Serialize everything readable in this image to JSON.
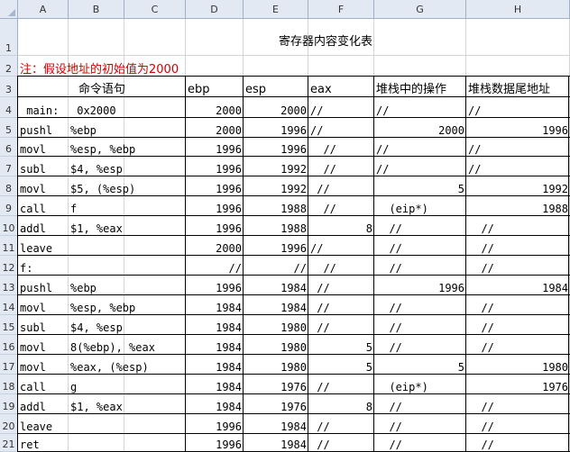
{
  "columns": [
    "A",
    "B",
    "C",
    "D",
    "E",
    "F",
    "G",
    "H"
  ],
  "rows": [
    "1",
    "2",
    "3",
    "4",
    "5",
    "6",
    "7",
    "8",
    "9",
    "10",
    "11",
    "12",
    "13",
    "14",
    "15",
    "16",
    "17",
    "18",
    "19",
    "20",
    "21"
  ],
  "title": "寄存器内容变化表",
  "note": "注：假设地址的初始值为2000",
  "headers": {
    "cmd": "命令语句",
    "ebp": "ebp",
    "esp": "esp",
    "eax": "eax",
    "op": "堆栈中的操作",
    "addr": "堆栈数据尾地址"
  },
  "table": [
    {
      "a": " main:",
      "b": " 0x2000",
      "d": "2000",
      "e": "2000",
      "f": "//",
      "g": "//",
      "h": "//"
    },
    {
      "a": "pushl",
      "b": "%ebp",
      "d": "2000",
      "e": "1996",
      "f": "//",
      "g": "2000",
      "h": "1996"
    },
    {
      "a": "movl",
      "b": "%esp, %ebp",
      "d": "1996",
      "e": "1996",
      "f": "  //",
      "g": "//",
      "h": "//"
    },
    {
      "a": "subl",
      "b": "$4, %esp",
      "d": "1996",
      "e": "1992",
      "f": "  //",
      "g": "//",
      "h": "//"
    },
    {
      "a": "movl",
      "b": "$5, (%esp)",
      "d": "1996",
      "e": "1992",
      "f": " //",
      "g": "5",
      "h": "1992"
    },
    {
      "a": "call",
      "b": "f",
      "d": "1996",
      "e": "1988",
      "f": "  //",
      "g": "  (eip*)",
      "h": "1988"
    },
    {
      "a": "addl",
      "b": "$1, %eax",
      "d": "1996",
      "e": "1988",
      "f": "8",
      "g": "  //",
      "h": "  //"
    },
    {
      "a": "leave",
      "b": "",
      "d": "2000",
      "e": "1996",
      "f": "//",
      "g": "  //",
      "h": "  //"
    },
    {
      "a": "f:",
      "b": "",
      "d": "//",
      "e": "//",
      "f": "  //",
      "g": "  //",
      "h": "  //"
    },
    {
      "a": "pushl",
      "b": "%ebp",
      "d": "1996",
      "e": "1984",
      "f": " //",
      "g": "1996",
      "h": "1984"
    },
    {
      "a": "movl",
      "b": "%esp, %ebp",
      "d": "1984",
      "e": "1984",
      "f": " //",
      "g": "  //",
      "h": "  //"
    },
    {
      "a": "subl",
      "b": "$4, %esp",
      "d": "1984",
      "e": "1980",
      "f": " //",
      "g": "  //",
      "h": "  //"
    },
    {
      "a": "movl",
      "b": "8(%ebp), %eax",
      "d": "1984",
      "e": "1980",
      "f": "5",
      "g": "  //",
      "h": "  //"
    },
    {
      "a": "movl",
      "b": "%eax, (%esp)",
      "d": "1984",
      "e": "1980",
      "f": "5",
      "g": "5",
      "h": "1980"
    },
    {
      "a": "call",
      "b": "g",
      "d": "1984",
      "e": "1976",
      "f": " //",
      "g": "  (eip*)",
      "h": "1976"
    },
    {
      "a": "addl",
      "b": "$1, %eax",
      "d": "1984",
      "e": "1976",
      "f": "8",
      "g": "  //",
      "h": "  //"
    },
    {
      "a": "leave",
      "b": "",
      "d": "1996",
      "e": "1984",
      "f": " //",
      "g": "  //",
      "h": "  //"
    },
    {
      "a": "ret",
      "b": "",
      "d": "1996",
      "e": "1984",
      "f": " //",
      "g": "  //",
      "h": "  //"
    }
  ],
  "colors": {
    "header_bg": "#e3e9f3",
    "note": "#d40000",
    "grid": "#d4d4d4",
    "table_border": "#000000"
  }
}
